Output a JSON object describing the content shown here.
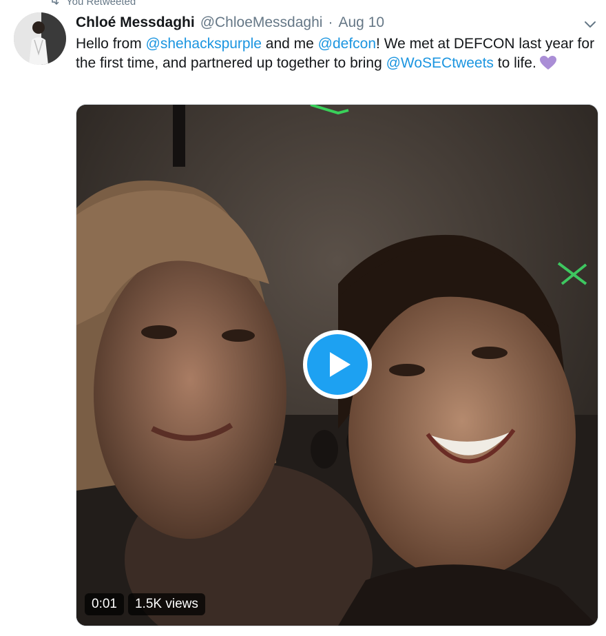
{
  "retweet": {
    "label": "You Retweeted"
  },
  "tweet": {
    "author_name": "Chloé Messdaghi",
    "handle": "@ChloeMessdaghi",
    "separator": "·",
    "date": "Aug 10",
    "text": {
      "part1": "Hello from ",
      "mention1": "@shehackspurple",
      "part2": " and me ",
      "mention2": "@defcon",
      "part3": "! We met at DEFCON last year for the first time, and partnered up together to bring ",
      "mention3": "@WoSECtweets",
      "part4": " to life."
    },
    "emoji": "purple-heart"
  },
  "video": {
    "duration": "0:01",
    "views": "1.5K views"
  },
  "colors": {
    "link": "#1b95e0",
    "play_button": "#1da1f2",
    "muted_text": "#657786"
  }
}
